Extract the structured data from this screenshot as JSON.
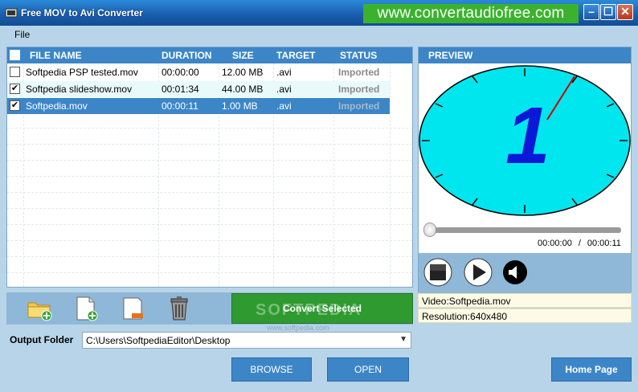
{
  "window": {
    "title": "Free MOV to Avi Converter",
    "promo_url": "www.convertaudiofree.com",
    "min_glyph": "–",
    "max_glyph": "☐",
    "close_glyph": "✕"
  },
  "menu": {
    "file": "File"
  },
  "table": {
    "headers": {
      "file_name": "FILE NAME",
      "duration": "DURATION",
      "size": "SIZE",
      "target": "TARGET",
      "status": "STATUS"
    },
    "rows": [
      {
        "checked": false,
        "name": "Softpedia PSP tested.mov",
        "duration": "00:00:00",
        "size": "12.00 MB",
        "target": ".avi",
        "status": "Imported"
      },
      {
        "checked": true,
        "name": "Softpedia slideshow.mov",
        "duration": "00:01:34",
        "size": "44.00 MB",
        "target": ".avi",
        "status": "Imported"
      },
      {
        "checked": true,
        "name": "Softpedia.mov",
        "duration": "00:00:11",
        "size": "1.00 MB",
        "target": ".avi",
        "status": "Imported"
      }
    ]
  },
  "toolbar": {
    "add_folder_icon": "folder-add-icon",
    "add_file_icon": "file-add-icon",
    "remove_icon": "file-remove-icon",
    "trash_icon": "trash-icon",
    "convert_label": "Convert Selected"
  },
  "output": {
    "label": "Output Folder",
    "path": "C:\\Users\\SoftpediaEditor\\Desktop"
  },
  "buttons": {
    "browse": "BROWSE",
    "open": "OPEN",
    "home": "Home Page"
  },
  "preview": {
    "header": "PREVIEW",
    "clock_digit": "1",
    "position_fraction": 0,
    "current_time": "00:00:00",
    "time_separator": "/",
    "total_time": "00:00:11",
    "stop_icon": "stop-icon",
    "play_icon": "play-icon",
    "volume_icon": "speaker-icon"
  },
  "info": {
    "video": "Video:Softpedia.mov",
    "resolution": "Resolution:640x480"
  },
  "watermark": {
    "text": "SOFTPEDIA",
    "sub": "www.softpedia.com"
  },
  "colors": {
    "accent": "#3c86c8",
    "convert": "#2e9a30",
    "promo": "#3bb22e",
    "clock_face": "#00e6ee"
  }
}
